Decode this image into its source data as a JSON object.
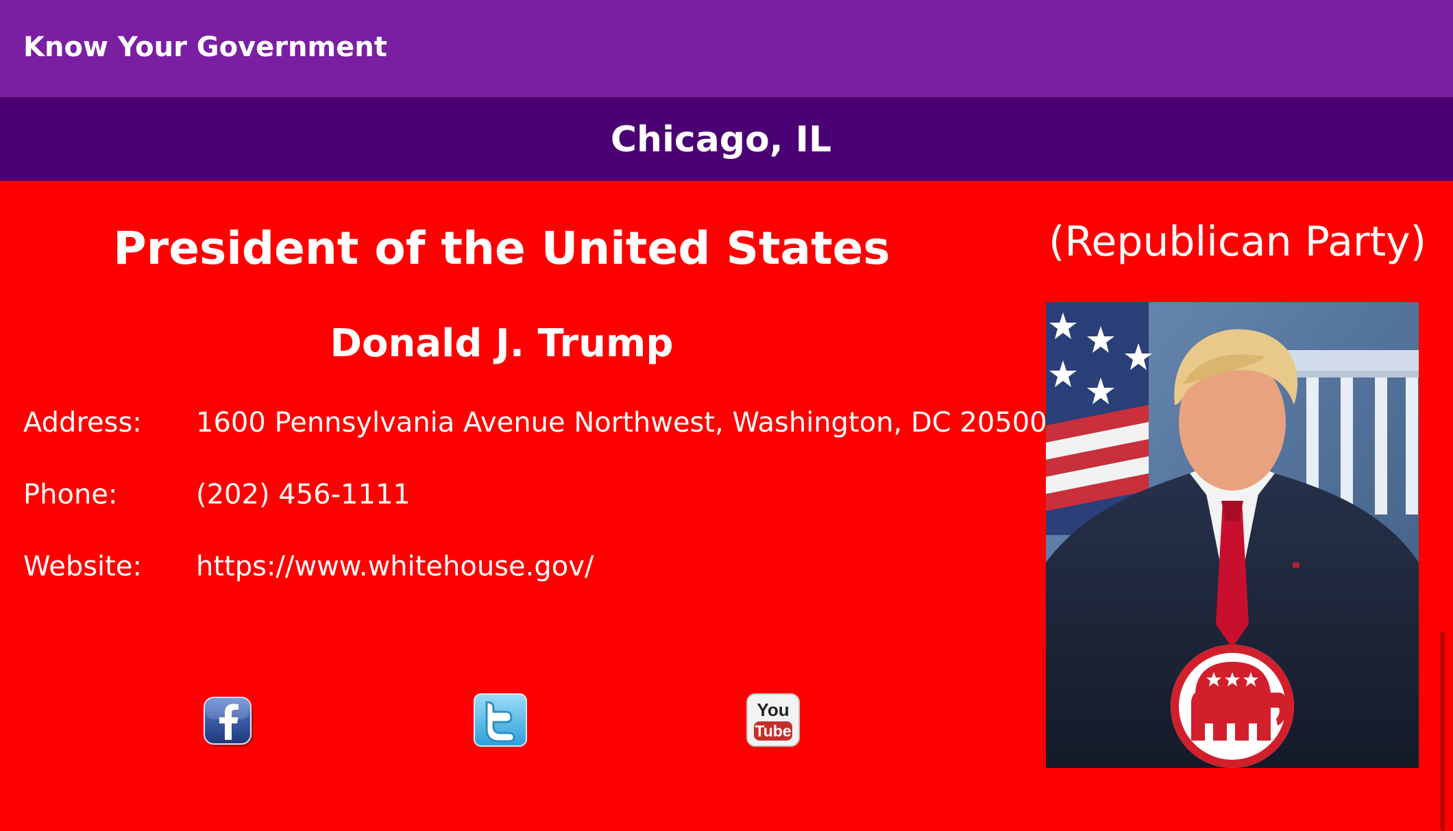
{
  "app": {
    "title": "Know Your Government"
  },
  "location": {
    "text": "Chicago, IL"
  },
  "official": {
    "office": "President of the United States",
    "party": "(Republican Party)",
    "name": "Donald J. Trump",
    "address_label": "Address:",
    "address": "1600 Pennsylvania Avenue Northwest, Washington, DC 20500",
    "phone_label": "Phone:",
    "phone": "(202) 456-1111",
    "website_label": "Website:",
    "website": "https://www.whitehouse.gov/",
    "party_color": "#ff0000"
  },
  "social": {
    "facebook_icon": "facebook-icon",
    "twitter_icon": "twitter-icon",
    "youtube_icon": "youtube-icon",
    "youtube_you": "You",
    "youtube_tube": "Tube"
  },
  "colors": {
    "appbar": "#7b1fa2",
    "location_bar": "#4a0072",
    "background": "#ff0000",
    "text": "#ffffff"
  }
}
